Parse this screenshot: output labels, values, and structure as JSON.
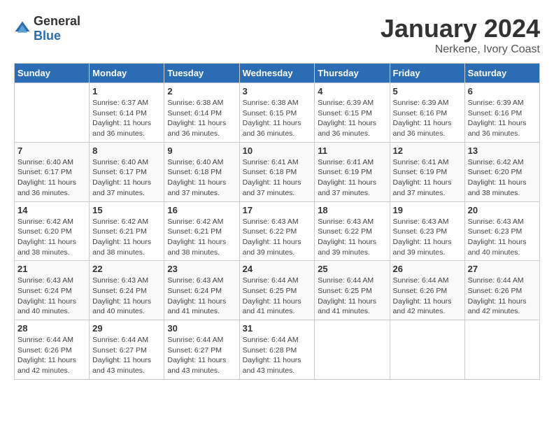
{
  "logo": {
    "text_general": "General",
    "text_blue": "Blue"
  },
  "title": "January 2024",
  "location": "Nerkene, Ivory Coast",
  "days_of_week": [
    "Sunday",
    "Monday",
    "Tuesday",
    "Wednesday",
    "Thursday",
    "Friday",
    "Saturday"
  ],
  "weeks": [
    [
      {
        "num": "",
        "sunrise": "",
        "sunset": "",
        "daylight": ""
      },
      {
        "num": "1",
        "sunrise": "Sunrise: 6:37 AM",
        "sunset": "Sunset: 6:14 PM",
        "daylight": "Daylight: 11 hours and 36 minutes."
      },
      {
        "num": "2",
        "sunrise": "Sunrise: 6:38 AM",
        "sunset": "Sunset: 6:14 PM",
        "daylight": "Daylight: 11 hours and 36 minutes."
      },
      {
        "num": "3",
        "sunrise": "Sunrise: 6:38 AM",
        "sunset": "Sunset: 6:15 PM",
        "daylight": "Daylight: 11 hours and 36 minutes."
      },
      {
        "num": "4",
        "sunrise": "Sunrise: 6:39 AM",
        "sunset": "Sunset: 6:15 PM",
        "daylight": "Daylight: 11 hours and 36 minutes."
      },
      {
        "num": "5",
        "sunrise": "Sunrise: 6:39 AM",
        "sunset": "Sunset: 6:16 PM",
        "daylight": "Daylight: 11 hours and 36 minutes."
      },
      {
        "num": "6",
        "sunrise": "Sunrise: 6:39 AM",
        "sunset": "Sunset: 6:16 PM",
        "daylight": "Daylight: 11 hours and 36 minutes."
      }
    ],
    [
      {
        "num": "7",
        "sunrise": "Sunrise: 6:40 AM",
        "sunset": "Sunset: 6:17 PM",
        "daylight": "Daylight: 11 hours and 36 minutes."
      },
      {
        "num": "8",
        "sunrise": "Sunrise: 6:40 AM",
        "sunset": "Sunset: 6:17 PM",
        "daylight": "Daylight: 11 hours and 37 minutes."
      },
      {
        "num": "9",
        "sunrise": "Sunrise: 6:40 AM",
        "sunset": "Sunset: 6:18 PM",
        "daylight": "Daylight: 11 hours and 37 minutes."
      },
      {
        "num": "10",
        "sunrise": "Sunrise: 6:41 AM",
        "sunset": "Sunset: 6:18 PM",
        "daylight": "Daylight: 11 hours and 37 minutes."
      },
      {
        "num": "11",
        "sunrise": "Sunrise: 6:41 AM",
        "sunset": "Sunset: 6:19 PM",
        "daylight": "Daylight: 11 hours and 37 minutes."
      },
      {
        "num": "12",
        "sunrise": "Sunrise: 6:41 AM",
        "sunset": "Sunset: 6:19 PM",
        "daylight": "Daylight: 11 hours and 37 minutes."
      },
      {
        "num": "13",
        "sunrise": "Sunrise: 6:42 AM",
        "sunset": "Sunset: 6:20 PM",
        "daylight": "Daylight: 11 hours and 38 minutes."
      }
    ],
    [
      {
        "num": "14",
        "sunrise": "Sunrise: 6:42 AM",
        "sunset": "Sunset: 6:20 PM",
        "daylight": "Daylight: 11 hours and 38 minutes."
      },
      {
        "num": "15",
        "sunrise": "Sunrise: 6:42 AM",
        "sunset": "Sunset: 6:21 PM",
        "daylight": "Daylight: 11 hours and 38 minutes."
      },
      {
        "num": "16",
        "sunrise": "Sunrise: 6:42 AM",
        "sunset": "Sunset: 6:21 PM",
        "daylight": "Daylight: 11 hours and 38 minutes."
      },
      {
        "num": "17",
        "sunrise": "Sunrise: 6:43 AM",
        "sunset": "Sunset: 6:22 PM",
        "daylight": "Daylight: 11 hours and 39 minutes."
      },
      {
        "num": "18",
        "sunrise": "Sunrise: 6:43 AM",
        "sunset": "Sunset: 6:22 PM",
        "daylight": "Daylight: 11 hours and 39 minutes."
      },
      {
        "num": "19",
        "sunrise": "Sunrise: 6:43 AM",
        "sunset": "Sunset: 6:23 PM",
        "daylight": "Daylight: 11 hours and 39 minutes."
      },
      {
        "num": "20",
        "sunrise": "Sunrise: 6:43 AM",
        "sunset": "Sunset: 6:23 PM",
        "daylight": "Daylight: 11 hours and 40 minutes."
      }
    ],
    [
      {
        "num": "21",
        "sunrise": "Sunrise: 6:43 AM",
        "sunset": "Sunset: 6:24 PM",
        "daylight": "Daylight: 11 hours and 40 minutes."
      },
      {
        "num": "22",
        "sunrise": "Sunrise: 6:43 AM",
        "sunset": "Sunset: 6:24 PM",
        "daylight": "Daylight: 11 hours and 40 minutes."
      },
      {
        "num": "23",
        "sunrise": "Sunrise: 6:43 AM",
        "sunset": "Sunset: 6:24 PM",
        "daylight": "Daylight: 11 hours and 41 minutes."
      },
      {
        "num": "24",
        "sunrise": "Sunrise: 6:44 AM",
        "sunset": "Sunset: 6:25 PM",
        "daylight": "Daylight: 11 hours and 41 minutes."
      },
      {
        "num": "25",
        "sunrise": "Sunrise: 6:44 AM",
        "sunset": "Sunset: 6:25 PM",
        "daylight": "Daylight: 11 hours and 41 minutes."
      },
      {
        "num": "26",
        "sunrise": "Sunrise: 6:44 AM",
        "sunset": "Sunset: 6:26 PM",
        "daylight": "Daylight: 11 hours and 42 minutes."
      },
      {
        "num": "27",
        "sunrise": "Sunrise: 6:44 AM",
        "sunset": "Sunset: 6:26 PM",
        "daylight": "Daylight: 11 hours and 42 minutes."
      }
    ],
    [
      {
        "num": "28",
        "sunrise": "Sunrise: 6:44 AM",
        "sunset": "Sunset: 6:26 PM",
        "daylight": "Daylight: 11 hours and 42 minutes."
      },
      {
        "num": "29",
        "sunrise": "Sunrise: 6:44 AM",
        "sunset": "Sunset: 6:27 PM",
        "daylight": "Daylight: 11 hours and 43 minutes."
      },
      {
        "num": "30",
        "sunrise": "Sunrise: 6:44 AM",
        "sunset": "Sunset: 6:27 PM",
        "daylight": "Daylight: 11 hours and 43 minutes."
      },
      {
        "num": "31",
        "sunrise": "Sunrise: 6:44 AM",
        "sunset": "Sunset: 6:28 PM",
        "daylight": "Daylight: 11 hours and 43 minutes."
      },
      {
        "num": "",
        "sunrise": "",
        "sunset": "",
        "daylight": ""
      },
      {
        "num": "",
        "sunrise": "",
        "sunset": "",
        "daylight": ""
      },
      {
        "num": "",
        "sunrise": "",
        "sunset": "",
        "daylight": ""
      }
    ]
  ]
}
